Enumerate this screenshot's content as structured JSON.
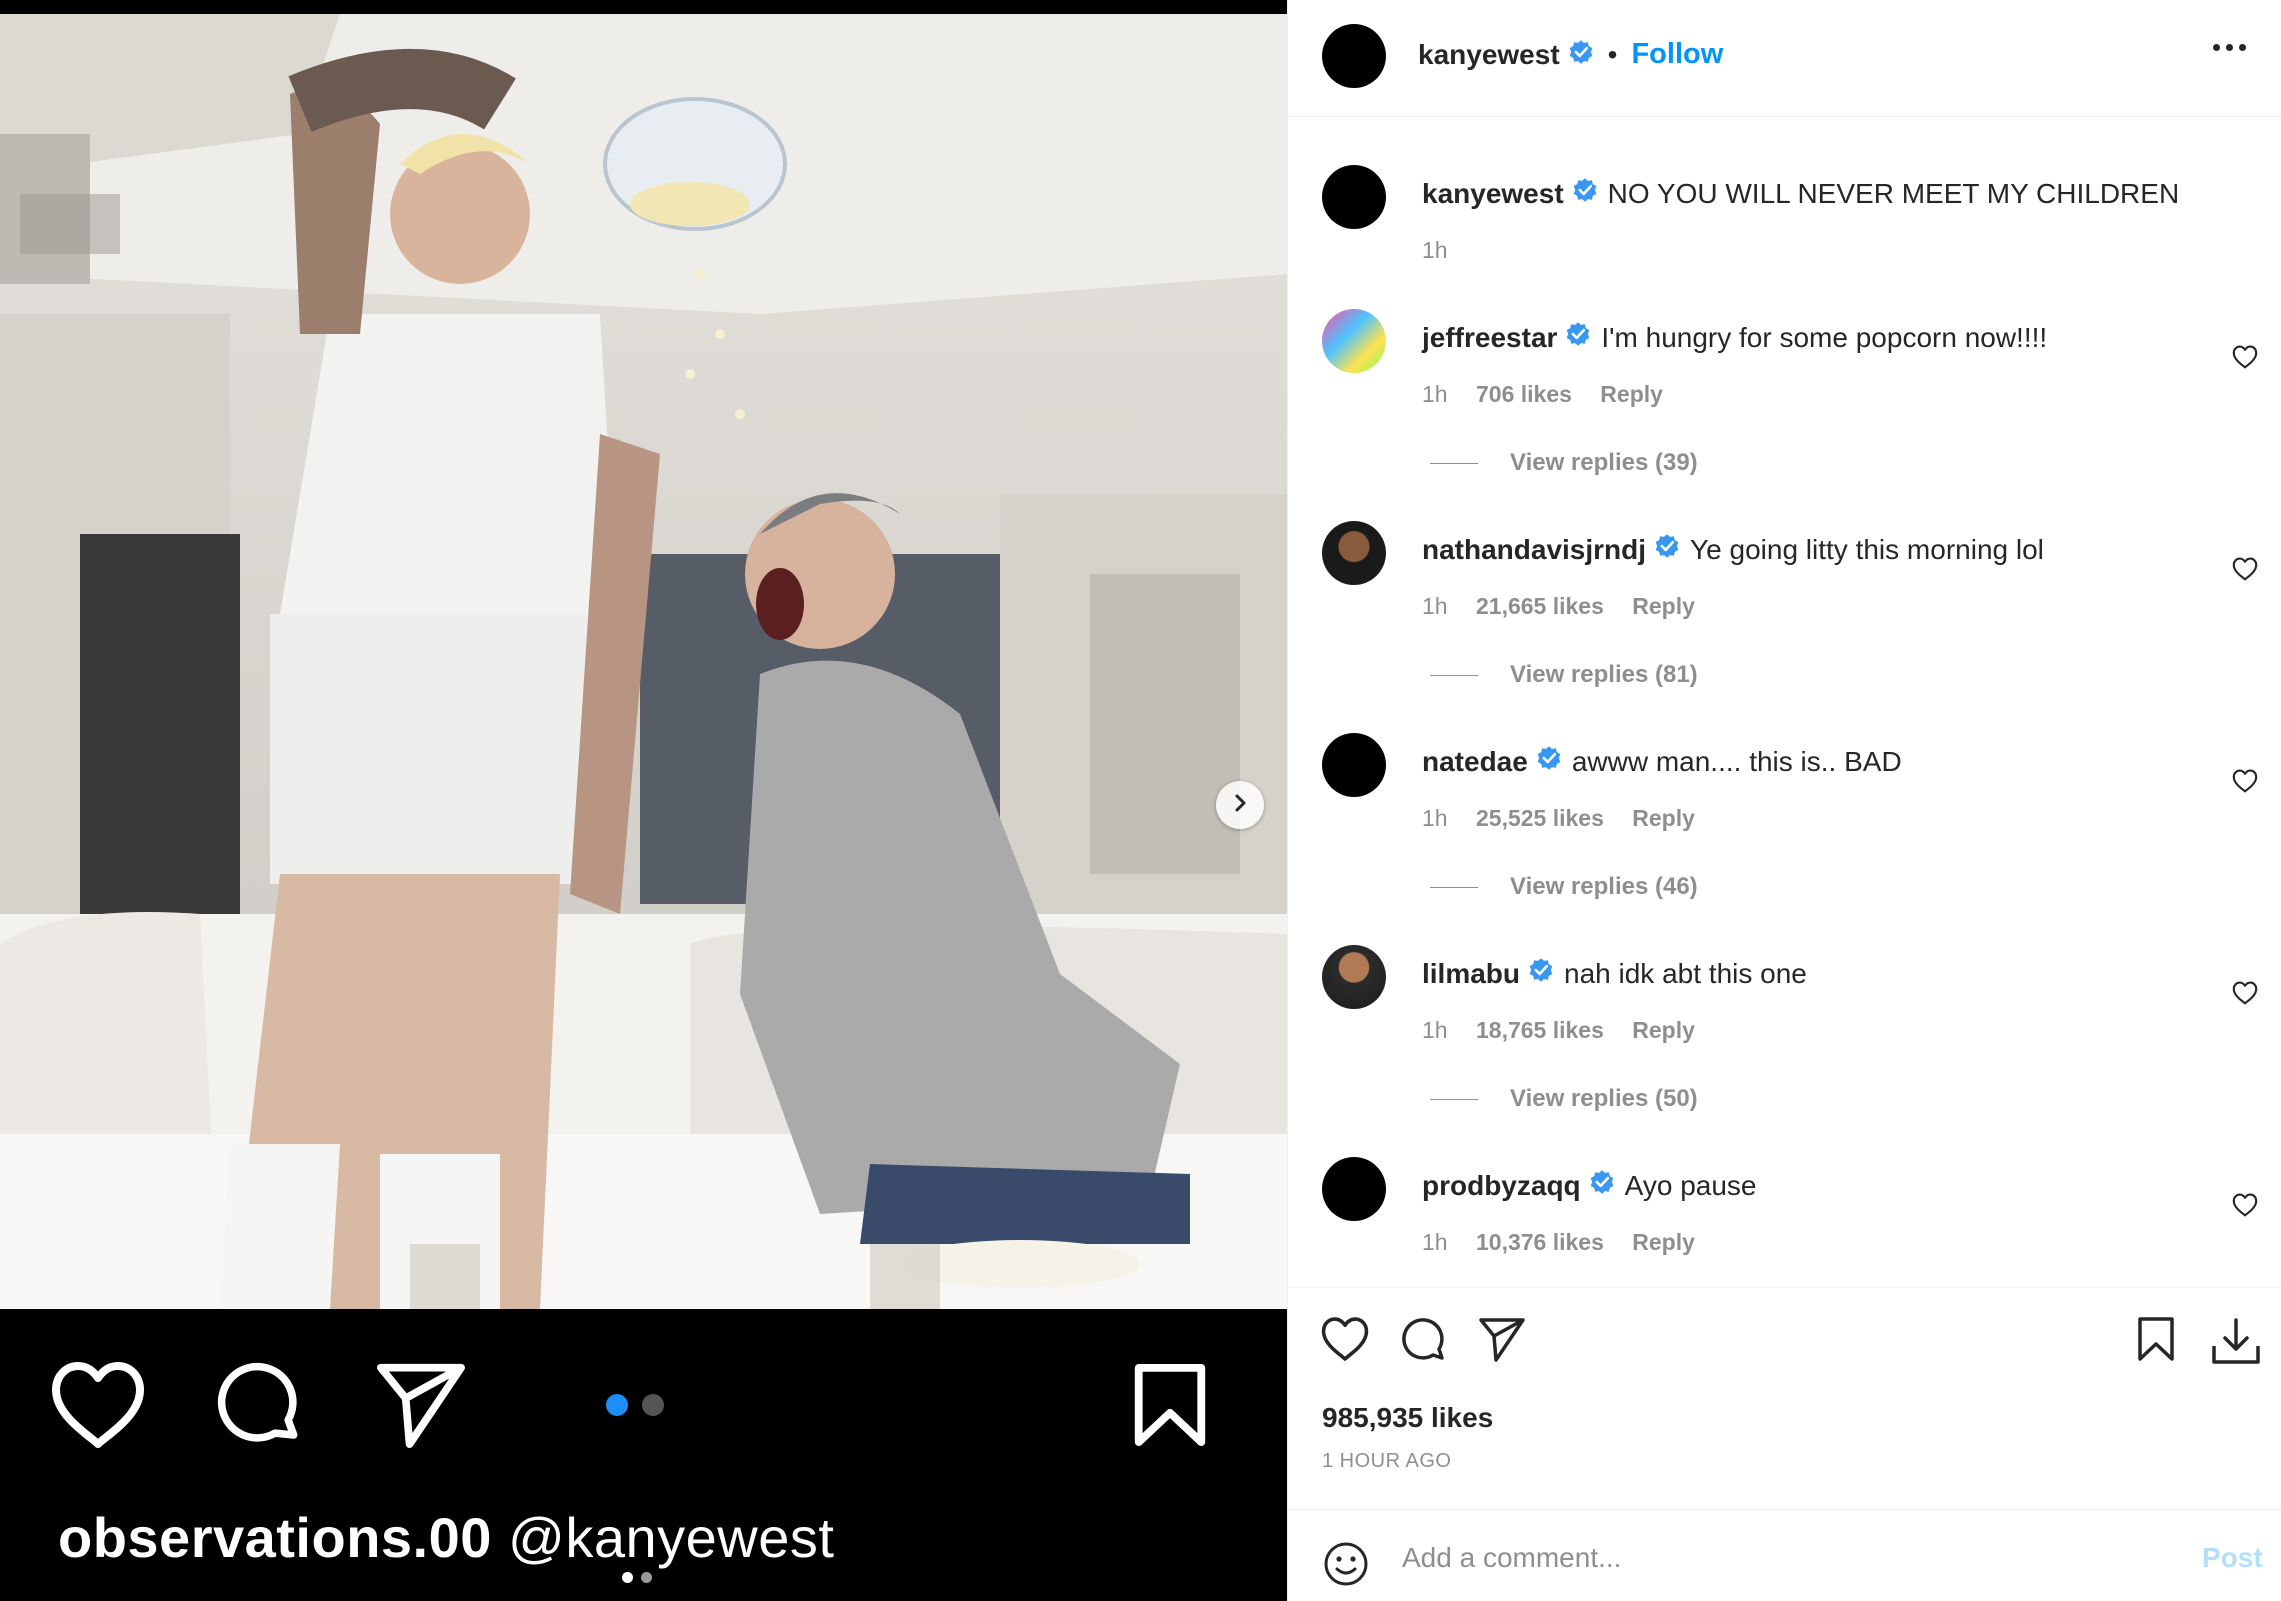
{
  "post": {
    "author": "kanyewest",
    "follow_label": "Follow",
    "separator": "•",
    "caption": "NO YOU WILL NEVER MEET MY CHILDREN",
    "caption_time": "1h",
    "likes": "985,935 likes",
    "time_ago": "1 HOUR AGO"
  },
  "media": {
    "credit_user": "observations.00",
    "credit_handle": "@kanyewest",
    "carousel": {
      "current": 1,
      "total": 2
    }
  },
  "comments": [
    {
      "user": "jeffreestar",
      "text": "I'm hungry for some popcorn now!!!!",
      "time": "1h",
      "likes": "706 likes",
      "reply": "Reply",
      "view_replies": "View replies (39)"
    },
    {
      "user": "nathandavisjrndj",
      "text": "Ye going litty this morning lol",
      "time": "1h",
      "likes": "21,665 likes",
      "reply": "Reply",
      "view_replies": "View replies (81)"
    },
    {
      "user": "natedae",
      "text": "awww man.... this is.. BAD",
      "time": "1h",
      "likes": "25,525 likes",
      "reply": "Reply",
      "view_replies": "View replies (46)"
    },
    {
      "user": "lilmabu",
      "text": "nah idk abt this one",
      "time": "1h",
      "likes": "18,765 likes",
      "reply": "Reply",
      "view_replies": "View replies (50)"
    },
    {
      "user": "prodbyzaqq",
      "text": "Ayo pause",
      "time": "1h",
      "likes": "10,376 likes",
      "reply": "Reply"
    }
  ],
  "comment_box": {
    "placeholder": "Add a comment...",
    "post_label": "Post"
  },
  "colors": {
    "link_blue": "#0095f6",
    "verified_blue": "#3897f0",
    "post_disabled": "#b2dffc",
    "secondary_text": "#8e8e8e"
  },
  "icons": [
    "heart-icon",
    "comment-icon",
    "share-icon",
    "bookmark-icon",
    "download-icon",
    "emoji-icon",
    "more-icon",
    "chevron-right-icon",
    "verified-icon"
  ]
}
